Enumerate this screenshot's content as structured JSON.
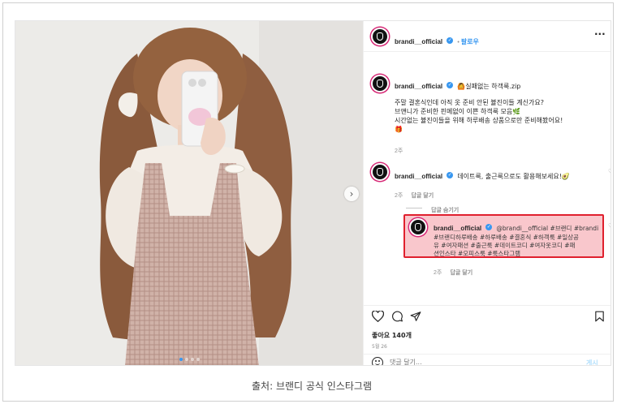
{
  "post": {
    "username": "brandi__official",
    "follow_label": "팔로우",
    "more_icon": "more-horizontal-icon",
    "verified_icon": "verified-badge-icon"
  },
  "caption": {
    "username": "brandi__official",
    "title": "🙆실패없는 하객룩.zip",
    "line1": "주말 결혼식인데 아직 옷 준비 안된 뷸진이들 계신가요?",
    "line2": "브얜니가 준비한 핀메없이 이쁜 하객룩 모음🌿",
    "line3": "시간없는 뷸진이들을 위해 하루배송 상품으로만 준비해봤어요!",
    "line4": "🎁",
    "time": "2주"
  },
  "comments": [
    {
      "username": "brandi__official",
      "text": "데이트룩, 출근룩으로도 활용해보세요!🥑",
      "time": "2주",
      "reply_label": "답글 달기"
    }
  ],
  "replies_toggle": "답글 숨기기",
  "reply": {
    "username": "brandi__official",
    "line1": "@brandi__official #브랜디 #brandi",
    "line2": "#브랜디하루배송 #하루배송 #결혼식 #하객룩 #일상공",
    "line3": "유 #여자패션 #출근룩 #데이트코디 #여자옷코디 #패",
    "line4": "션인스타 #오피스룩 #룩스타그램",
    "time": "2주",
    "reply_label": "답글 달기"
  },
  "footer": {
    "likes": "좋아요 140개",
    "date": "5월 26",
    "comment_placeholder": "댓글 달기...",
    "post_label": "게시"
  },
  "image_caption": "출처: 브랜디 공식 인스타그램",
  "colors": {
    "link": "#3897f0",
    "highlight_border": "#e0202e",
    "highlight_fill": "#f9c7cc"
  }
}
